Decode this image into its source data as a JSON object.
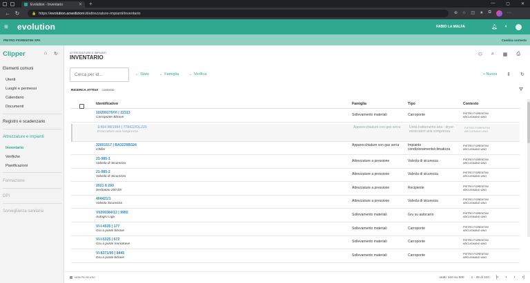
{
  "browser": {
    "tab_title": "Evolution - Inventario",
    "url_host": "evolution.arsedizioni.it",
    "url_path": "/attrezzature-impianti/inventario",
    "url_scheme": "https://"
  },
  "app": {
    "logo": "evolution",
    "user_name": "FABIO LA MALFA",
    "company": "PIETRO FIORENTINI SPA",
    "change_context": "Cambia contesto",
    "accent": "#2fa88f"
  },
  "sidebar": {
    "brand": "Clipper",
    "items": [
      {
        "label": "Elementi comuni"
      },
      {
        "label": "Utenti"
      },
      {
        "label": "Luoghi e permessi"
      },
      {
        "label": "Calendario"
      },
      {
        "label": "Documenti"
      },
      {
        "label": "Registro e scadenzario"
      },
      {
        "label": "Attrezzature e impianti"
      },
      {
        "label": "Inventario"
      },
      {
        "label": "Verifiche"
      },
      {
        "label": "Pianificazioni"
      },
      {
        "label": "Formazione"
      },
      {
        "label": "DPI"
      },
      {
        "label": "Sorveglianza sanitaria"
      }
    ]
  },
  "main": {
    "breadcrumb": "ATTREZZATURE E IMPIANTI",
    "title": "INVENTARIO",
    "search_placeholder": "Cerca per id...",
    "filters": [
      "Stato",
      "Famiglia",
      "Verifica"
    ],
    "new_label": "Nuova",
    "active_search_label": "RICERCA ATTIVA",
    "active_search_value": "contesto",
    "columns": [
      "Identificativo",
      "Famiglia",
      "Tipo",
      "Contesto"
    ],
    "rows": [
      {
        "id": "10/200270/VI | 22313",
        "desc": "Carroponte Bitrave",
        "fam": "Sollevamento materiali",
        "tipo": "Carroponte",
        "ctx1": "PIETRO FIORENTINI",
        "ctx2": "ARCUGNANO UNO"
      },
      {
        "id": "1/404 IM/1994 | 778422/DL220",
        "desc": "Essiccatore aria compressa",
        "fam": "Apparecchiature con gas serra",
        "tipo": "Unità trattamento aria - dryer-essiccatori aria compressa",
        "ctx1": "PIETRO FIORENTINI",
        "ctx2": "ARCUGNANO UNO"
      },
      {
        "id": "32001517 | BA3229B324",
        "desc": "Chiller",
        "fam": "Apparecchiature con gas serra",
        "tipo": "Impianto condizionamento/climatizza",
        "ctx1": "PIETRO FIORENTINI",
        "ctx2": "ARCUGNANO UNO"
      },
      {
        "id": "21-985-1",
        "desc": "Valvola di Sicurezza",
        "fam": "Attrezzature a pressione",
        "tipo": "Valvola di sicurezza",
        "ctx1": "PIETRO FIORENTINI",
        "ctx2": "ARCUGNANO UNO"
      },
      {
        "id": "21-985-2",
        "desc": "Valvola di Sicurezza",
        "fam": "Attrezzature a pressione",
        "tipo": "Valvola di sicurezza",
        "ctx1": "PIETRO FIORENTINI",
        "ctx2": "ARCUGNANO UNO"
      },
      {
        "id": "2021 8 260",
        "desc": "Serbatoio 200 litri",
        "fam": "Attrezzature a pressione",
        "tipo": "Recipiente",
        "ctx1": "PIETRO FIORENTINI",
        "ctx2": "ARCUGNANO UNO"
      },
      {
        "id": "404421/1",
        "desc": "Valvola Sicurezza",
        "fam": "Attrezzature a pressione",
        "tipo": "Valvola di sicurezza",
        "ctx1": "PIETRO FIORENTINI",
        "ctx2": "ARCUGNANO UNO"
      },
      {
        "id": "VI/200384/12 | 9902",
        "desc": "Autogru Ligo",
        "fam": "Sollevamento materiali",
        "tipo": "Gru su autocarro",
        "ctx1": "PIETRO FIORENTINI",
        "ctx2": "ARCUGNANO UNO"
      },
      {
        "id": "VI-I-4535 | 177",
        "desc": "Gru a ponte bitrave",
        "fam": "Sollevamento materiali",
        "tipo": "Carroponte",
        "ctx1": "PIETRO FIORENTINI",
        "ctx2": "ARCUGNANO UNO"
      },
      {
        "id": "VI-I-5325 | 672",
        "desc": "Gru a ponte monotrave",
        "fam": "Sollevamento materiali",
        "tipo": "Carroponte",
        "ctx1": "PIETRO FIORENTINI",
        "ctx2": "ARCUGNANO UNO"
      },
      {
        "id": "VI-8371/95 | 8445",
        "desc": "Gru a ponte bitrave",
        "fam": "Sollevamento materiali",
        "tipo": "Carroponte",
        "ctx1": "PIETRO FIORENTINI",
        "ctx2": "ARCUGNANO UNO"
      }
    ],
    "footer_legend": "NON PIÙ IN USO",
    "usati": "usati: 110 su 500",
    "range": "1 - 25 di 110"
  }
}
